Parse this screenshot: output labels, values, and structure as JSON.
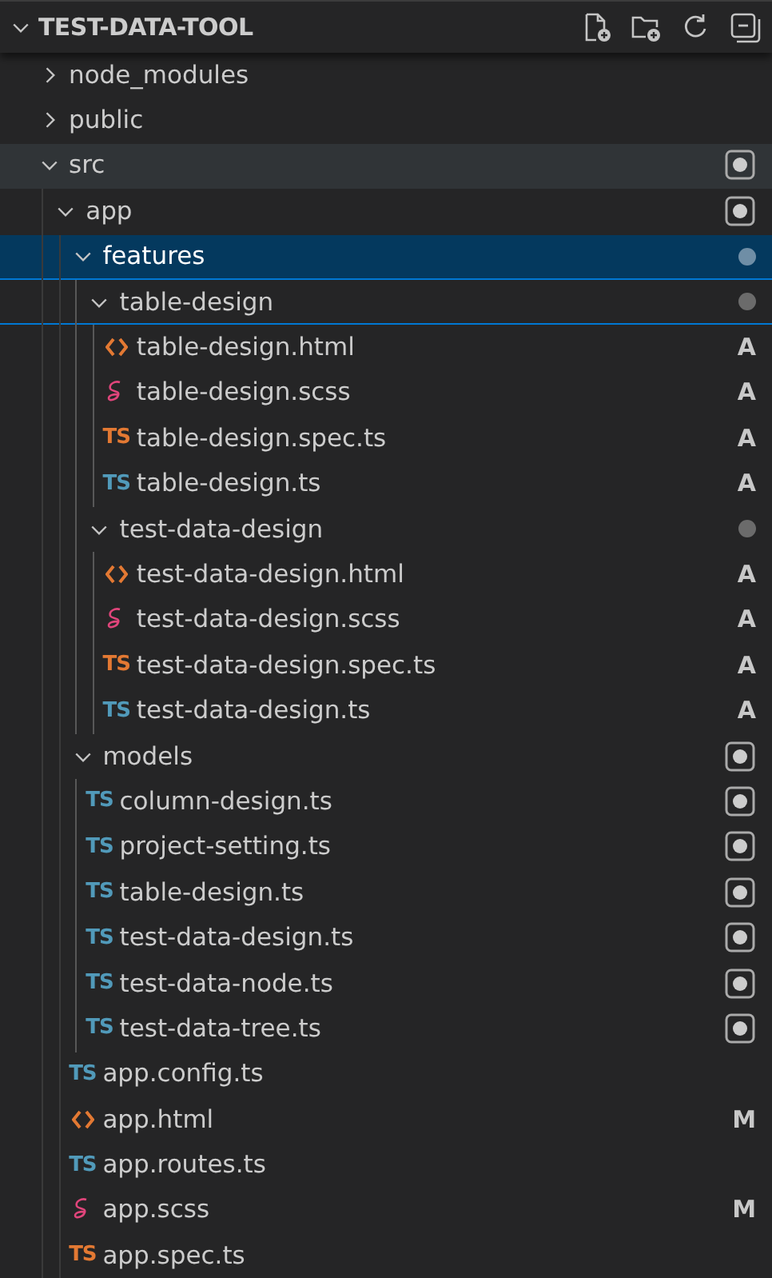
{
  "header": {
    "title": "TEST-DATA-TOOL",
    "expanded": true
  },
  "tree": [
    {
      "name": "node_modules",
      "kind": "folder",
      "expanded": false
    },
    {
      "name": "public",
      "kind": "folder",
      "expanded": false
    },
    {
      "name": "src",
      "kind": "folder",
      "expanded": true,
      "hovered": true,
      "marker": {
        "kind": "ring"
      },
      "children": [
        {
          "name": "app",
          "kind": "folder",
          "expanded": true,
          "marker": {
            "kind": "ring"
          },
          "children": [
            {
              "name": "features",
              "kind": "folder",
              "expanded": true,
              "selected": true,
              "outlined": true,
              "marker": {
                "kind": "dot"
              },
              "children": [
                {
                  "name": "table-design",
                  "kind": "folder",
                  "expanded": true,
                  "outlined": true,
                  "marker": {
                    "kind": "dot"
                  },
                  "children": [
                    {
                      "name": "table-design.html",
                      "kind": "html",
                      "status": "A"
                    },
                    {
                      "name": "table-design.scss",
                      "kind": "scss",
                      "status": "A"
                    },
                    {
                      "name": "table-design.spec.ts",
                      "kind": "ts-spec",
                      "icon_text": "TS",
                      "status": "A"
                    },
                    {
                      "name": "table-design.ts",
                      "kind": "ts",
                      "icon_text": "TS",
                      "status": "A"
                    }
                  ]
                },
                {
                  "name": "test-data-design",
                  "kind": "folder",
                  "expanded": true,
                  "marker": {
                    "kind": "dot"
                  },
                  "children": [
                    {
                      "name": "test-data-design.html",
                      "kind": "html",
                      "status": "A"
                    },
                    {
                      "name": "test-data-design.scss",
                      "kind": "scss",
                      "status": "A"
                    },
                    {
                      "name": "test-data-design.spec.ts",
                      "kind": "ts-spec",
                      "icon_text": "TS",
                      "status": "A"
                    },
                    {
                      "name": "test-data-design.ts",
                      "kind": "ts",
                      "icon_text": "TS",
                      "status": "A"
                    }
                  ]
                }
              ]
            },
            {
              "name": "models",
              "kind": "folder",
              "expanded": true,
              "marker": {
                "kind": "ring"
              },
              "children": [
                {
                  "name": "column-design.ts",
                  "kind": "ts",
                  "icon_text": "TS",
                  "marker": {
                    "kind": "ring"
                  }
                },
                {
                  "name": "project-setting.ts",
                  "kind": "ts",
                  "icon_text": "TS",
                  "marker": {
                    "kind": "ring"
                  }
                },
                {
                  "name": "table-design.ts",
                  "kind": "ts",
                  "icon_text": "TS",
                  "marker": {
                    "kind": "ring"
                  }
                },
                {
                  "name": "test-data-design.ts",
                  "kind": "ts",
                  "icon_text": "TS",
                  "marker": {
                    "kind": "ring"
                  }
                },
                {
                  "name": "test-data-node.ts",
                  "kind": "ts",
                  "icon_text": "TS",
                  "marker": {
                    "kind": "ring"
                  }
                },
                {
                  "name": "test-data-tree.ts",
                  "kind": "ts",
                  "icon_text": "TS",
                  "marker": {
                    "kind": "ring"
                  }
                }
              ]
            },
            {
              "name": "app.config.ts",
              "kind": "ts",
              "icon_text": "TS"
            },
            {
              "name": "app.html",
              "kind": "html",
              "status": "M"
            },
            {
              "name": "app.routes.ts",
              "kind": "ts",
              "icon_text": "TS"
            },
            {
              "name": "app.scss",
              "kind": "scss",
              "status": "M"
            },
            {
              "name": "app.spec.ts",
              "kind": "ts-spec",
              "icon_text": "TS"
            }
          ]
        }
      ]
    }
  ]
}
